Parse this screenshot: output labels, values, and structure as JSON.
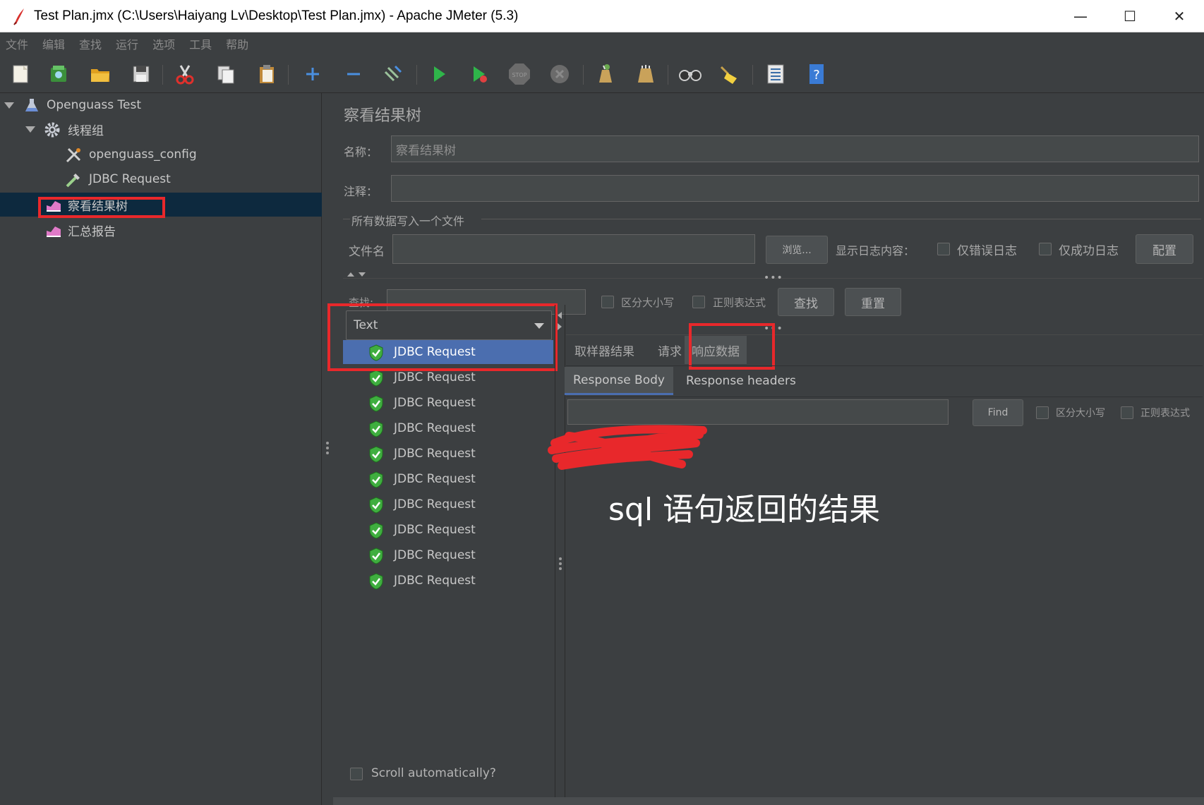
{
  "window": {
    "title": "Test Plan.jmx (C:\\Users\\Haiyang Lv\\Desktop\\Test Plan.jmx) - Apache JMeter (5.3)",
    "minimize": "—",
    "maximize": "☐",
    "close": "✕"
  },
  "menu": [
    "文件",
    "编辑",
    "查找",
    "运行",
    "选项",
    "工具",
    "帮助"
  ],
  "toolbar": {
    "icons": [
      "new-icon",
      "templates-icon",
      "open-icon",
      "save-icon",
      "cut-icon",
      "copy-icon",
      "paste-icon",
      "expand-icon",
      "collapse-icon",
      "toggle-icon",
      "start-icon",
      "start-no-pause-icon",
      "stop-icon",
      "shutdown-icon",
      "clear-icon",
      "clear-all-icon",
      "search-icon",
      "reset-search-icon",
      "function-helper-icon",
      "help-icon"
    ],
    "stop_label": "STOP",
    "help_label": "?"
  },
  "tree": {
    "test_plan": "Openguass Test",
    "thread_group": "线程组",
    "config": "openguass_config",
    "jdbc_request": "JDBC Request",
    "result_tree": "察看结果树",
    "summary_report": "汇总报告"
  },
  "panel": {
    "title": "察看结果树",
    "name_label": "名称：",
    "name_value": "察看结果树",
    "comment_label": "注释：",
    "comment_value": "",
    "file_group_label": "所有数据写入一个文件",
    "filename_label": "文件名",
    "filename_value": "",
    "browse_button": "浏览...",
    "log_display_label": "显示日志内容：",
    "errors_only_label": "仅错误日志",
    "success_only_label": "仅成功日志",
    "configure_button": "配置"
  },
  "search": {
    "label": "查找:",
    "value": "",
    "case_sensitive": "区分大小写",
    "regex": "正则表达式",
    "find_button": "查找",
    "reset_button": "重置"
  },
  "results": {
    "renderer": "Text",
    "items": [
      "JDBC Request",
      "JDBC Request",
      "JDBC Request",
      "JDBC Request",
      "JDBC Request",
      "JDBC Request",
      "JDBC Request",
      "JDBC Request",
      "JDBC Request",
      "JDBC Request"
    ],
    "scroll_auto": "Scroll automatically?"
  },
  "detail": {
    "tabs": [
      "取样器结果",
      "请求",
      "响应数据"
    ],
    "active_tab": "响应数据",
    "subtabs": [
      "Response Body",
      "Response headers"
    ],
    "active_subtab": "Response Body",
    "find_value": "",
    "find_button": "Find",
    "case_sensitive": "区分大小写",
    "regex": "正则表达式"
  },
  "annotation": "sql 语句返回的结果",
  "colors": {
    "background": "#3c3f41",
    "selected_list": "#4b6eaf",
    "selected_tree": "#0d293e",
    "highlight_box": "#e8282b",
    "success_shield": "#3fae3f"
  }
}
